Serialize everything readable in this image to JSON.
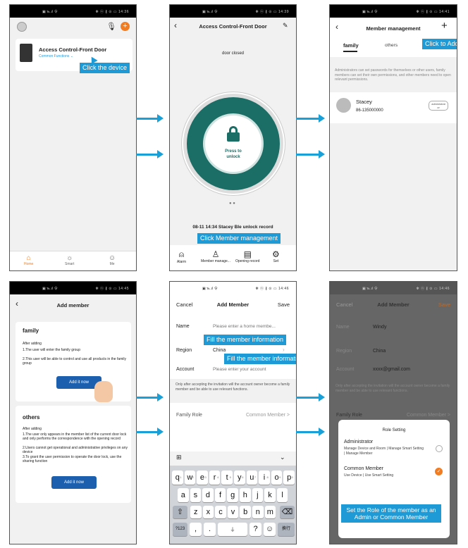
{
  "status_bar": {
    "p1": {
      "left": "▣ ℡.ıl 令",
      "right": "✻ ⓝ ∦ ⊙ ▭ 14:36"
    },
    "p2": {
      "left": "▣ ℡.ıl 令",
      "right": "✻ ⓝ ∦ ⊙ ▭ 14:39"
    },
    "p3": {
      "left": "▣ ℡.ıl 令",
      "right": "✻ ⓝ ∦ ⊙ ▭ 14:41"
    },
    "p4": {
      "left": "▣ ℡.ıl 令",
      "right": "✻ ⓝ ∦ ⊙ ▭ 14:45"
    },
    "p5": {
      "left": "▣ ℡.ıl 令",
      "right": "✻ ⓝ ∦ ⊙ ▭ 14:46"
    },
    "p6": {
      "left": "▣ ℡.ıl 令",
      "right": "✻ ⓝ ∦ ⊙ ▭ 14:46"
    }
  },
  "home": {
    "device_name": "Access Control-Front Door",
    "device_sub": "Common Functions ⌄",
    "callout": "Click the device",
    "nav": [
      {
        "label": "Home"
      },
      {
        "label": "Smart"
      },
      {
        "label": "Me"
      }
    ]
  },
  "device": {
    "title": "Access Control-Front Door",
    "status": "door closed",
    "unlock_line1": "Press to",
    "unlock_line2": "unlock",
    "record": "08-11 14:34 Stacey Ble unlock record",
    "callout": "Click Member management",
    "tabs": [
      "Alarm",
      "Member manage...",
      "Opening record",
      "Set"
    ]
  },
  "members": {
    "title": "Member management",
    "tab_family": "family",
    "tab_others": "others",
    "callout": "Click to Add",
    "info": "Administrators can set passwords for themselves or other users, family members can set their own permissions, and other members need to open relevant permissions.",
    "member_name": "Stacey",
    "member_phone": "86-135000000",
    "member_badge": "administrat or"
  },
  "add_member_type": {
    "title": "Add member",
    "family_title": "family",
    "family_after": "After adding",
    "family_l1": "1.The user will enter the family group",
    "family_l2": "2.This user will be able to control and use all products in the family group",
    "family_btn": "Add it now",
    "others_title": "others",
    "others_after": "After adding",
    "others_l1": "1.The user only appears in the member list of the current door lock and only performs the correspondence with the opening record",
    "others_l2": "2.Users cannot get operational and administrative privileges on any device",
    "others_l3": "3.To grant the user permission to operate the door lock, use the sharing function",
    "others_btn": "Add it now"
  },
  "add_member_form": {
    "cancel": "Cancel",
    "title": "Add Member",
    "save": "Save",
    "name_label": "Name",
    "name_placeholder": "Please enter a home membe...",
    "region_label": "Region",
    "region_value": "China",
    "account_label": "Account",
    "account_placeholder": "Please enter your account",
    "note": "Only after accepting the invitation will the account owner become a family member and be able to use relevant functions.",
    "role_label": "Family Role",
    "role_value": "Common Member >",
    "callout1": "Fill the member information",
    "callout2": "Fill the member information",
    "kb_row1": [
      "q",
      "w",
      "e",
      "r",
      "t",
      "y",
      "u",
      "i",
      "o",
      "p"
    ],
    "kb_row1_num": [
      "1",
      "2",
      "3",
      "4",
      "5",
      "6",
      "7",
      "8",
      "9",
      "0"
    ],
    "kb_row2": [
      "a",
      "s",
      "d",
      "f",
      "g",
      "h",
      "j",
      "k",
      "l"
    ],
    "kb_row3": [
      "z",
      "x",
      "c",
      "v",
      "b",
      "n",
      "m"
    ],
    "kb_num": "?123",
    "kb_comma": ",",
    "kb_dot": ".",
    "kb_q": "?",
    "kb_enter": "换行"
  },
  "role_setting": {
    "cancel": "Cancel",
    "title": "Add Member",
    "save": "Save",
    "name_label": "Name",
    "name_value": "Windy",
    "region_label": "Region",
    "region_value": "China",
    "account_label": "Account",
    "account_value": "xxxx@gmail.com",
    "note": "Only after accepting the invitation will the account owner become a family member and be able to use relevant functions.",
    "role_label": "Family Role",
    "role_value": "Common Member >",
    "sheet_title": "Role Setting",
    "admin_title": "Administrator",
    "admin_desc": "Manage Device and Room | Manage Smart Setting | Manage Member",
    "common_title": "Common Member",
    "common_desc": "Use Device | Use Smart Setting",
    "callout": "Set the Role of the member as an Admin or Common Member"
  },
  "colors": {
    "accent": "#1e9bd7",
    "teal": "#1b6e66",
    "orange": "#f07c24",
    "btn_blue": "#1b5fae"
  }
}
